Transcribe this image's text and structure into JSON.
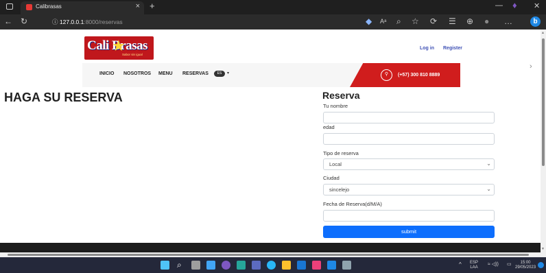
{
  "browser": {
    "tab_title": "Calibrasas",
    "tab_close": "×",
    "new_tab": "+",
    "address_host": "127.0.0.1",
    "address_path": ":8000/reservas",
    "security_icon": "info-icon"
  },
  "site": {
    "logo_text": "Cali Brasas",
    "logo_tagline": "Sabor sin igual",
    "auth": {
      "login": "Log in",
      "register": "Register"
    },
    "nav": [
      {
        "label": "INICIO"
      },
      {
        "label": "NOSOTROS"
      },
      {
        "label": "MENU"
      },
      {
        "label": "RESERVAS"
      }
    ],
    "lang_pill": "ES",
    "phone": "(+57) 300 810 8889"
  },
  "page": {
    "heading": "HAGA SU RESERVA"
  },
  "form": {
    "title": "Reserva",
    "fields": {
      "name_label": "Tu nombre",
      "age_label": "edad",
      "type_label": "Tipo de reserva",
      "type_value": "Local",
      "city_label": "Ciudad",
      "city_value": "sincelejo",
      "date_label": "Fecha de Reserva(d/M/A)"
    },
    "submit": "submit"
  },
  "taskbar": {
    "lang": "ESP",
    "lang_sub": "LAA",
    "time": "15:00",
    "date": "29/05/2023"
  },
  "colors": {
    "brand_red": "#d01d1d",
    "primary_blue": "#0d6efd",
    "link_blue": "#3f51b5"
  }
}
